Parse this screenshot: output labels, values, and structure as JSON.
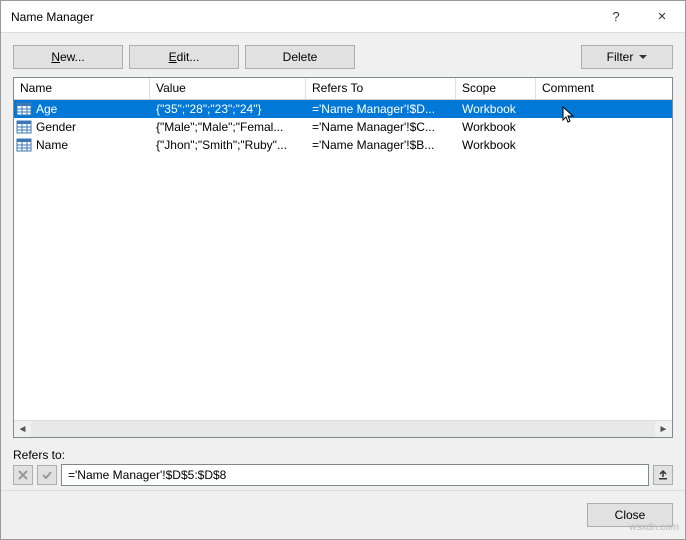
{
  "window": {
    "title": "Name Manager",
    "help": "?",
    "close": "×"
  },
  "toolbar": {
    "new_label": "New...",
    "edit_label": "Edit...",
    "delete_label": "Delete",
    "filter_label": "Filter"
  },
  "columns": {
    "name": "Name",
    "value": "Value",
    "refers": "Refers To",
    "scope": "Scope",
    "comment": "Comment"
  },
  "rows": [
    {
      "name": "Age",
      "value": "{\"35\";\"28\";\"23\";\"24\"}",
      "refers": "='Name Manager'!$D...",
      "scope": "Workbook",
      "comment": "",
      "selected": true
    },
    {
      "name": "Gender",
      "value": "{\"Male\";\"Male\";\"Femal...",
      "refers": "='Name Manager'!$C...",
      "scope": "Workbook",
      "comment": "",
      "selected": false
    },
    {
      "name": "Name",
      "value": "{\"Jhon\";\"Smith\";\"Ruby\"...",
      "refers": "='Name Manager'!$B...",
      "scope": "Workbook",
      "comment": "",
      "selected": false
    }
  ],
  "refers_section": {
    "label": "Refers to:",
    "value": "='Name Manager'!$D$5:$D$8"
  },
  "footer": {
    "close_label": "Close"
  },
  "watermark": "wsxdn.com"
}
